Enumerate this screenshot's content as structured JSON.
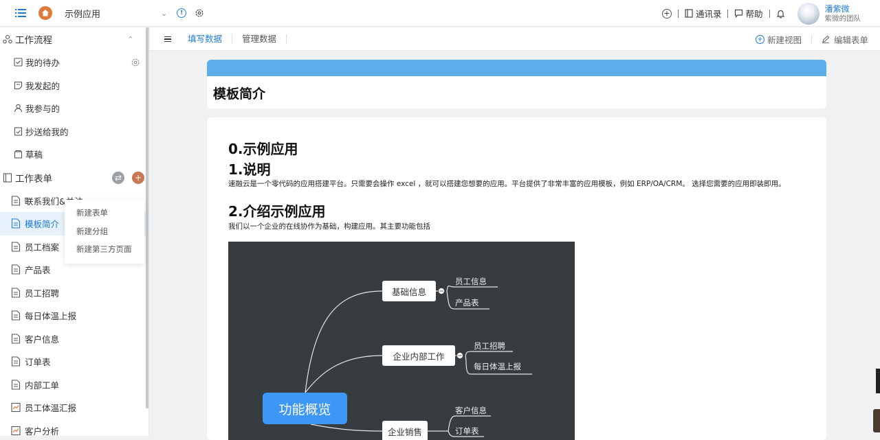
{
  "topbar": {
    "app_name": "示例应用",
    "contacts": "通讯录",
    "help": "帮助",
    "user_name": "潘紫微",
    "user_team": "紫微的团队"
  },
  "sidebar": {
    "workflow_title": "工作流程",
    "workflow_items": [
      "我的待办",
      "我发起的",
      "我参与的",
      "抄送给我的",
      "草稿"
    ],
    "forms_title": "工作表单",
    "form_items": [
      "联系我们&关注",
      "模板简介",
      "员工档案",
      "产品表",
      "员工招聘",
      "每日体温上报",
      "客户信息",
      "订单表",
      "内部工单",
      "员工体温汇报",
      "客户分析"
    ]
  },
  "dropdown": {
    "items": [
      "新建表单",
      "新建分组",
      "新建第三方页面"
    ]
  },
  "subbar": {
    "tab_fill": "填写数据",
    "tab_manage": "管理数据",
    "new_view": "新建视图",
    "edit_form": "编辑表单"
  },
  "content": {
    "card_title": "模板简介",
    "h_sample": "0.示例应用",
    "h_explain": "1.说明",
    "p_explain": "速融云是一个零代码的应用搭建平台。只需要会操作 excel ，就可以搭建您想要的应用。平台提供了非常丰富的应用模板，例如 ERP/OA/CRM。 选择您需要的应用即装即用。",
    "h_intro": "2.介绍示例应用",
    "p_intro": "我们以一个企业的在线协作为基础，构建应用。其主要功能包括"
  },
  "mindmap": {
    "center": "功能概览",
    "branches": [
      {
        "label": "基础信息",
        "leaves": [
          "员工信息",
          "产品表"
        ]
      },
      {
        "label": "企业内部工作",
        "leaves": [
          "员工招聘",
          "每日体温上报"
        ]
      },
      {
        "label": "企业销售",
        "leaves": [
          "客户信息",
          "订单表"
        ]
      }
    ]
  },
  "colors": {
    "accent": "#1f7bd6",
    "header_bar": "#5daeea",
    "mindmap_bg": "#373c40",
    "center_node": "#3d98f5"
  }
}
